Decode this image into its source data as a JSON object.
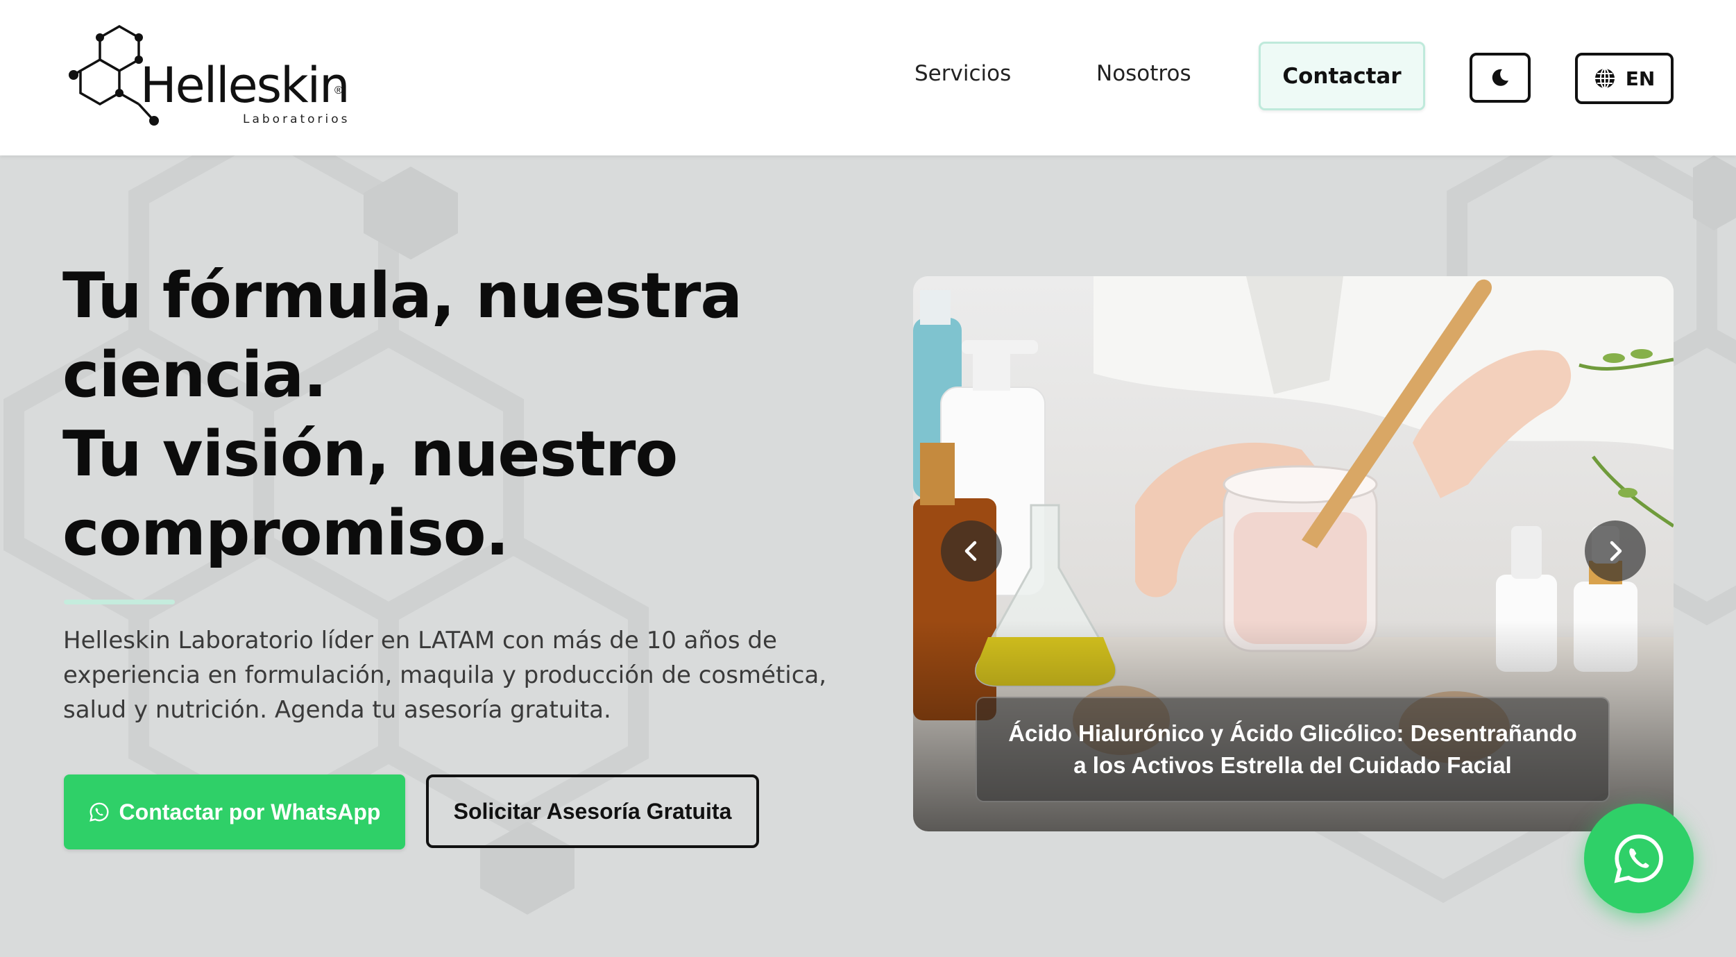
{
  "brand": {
    "name": "Helleskin",
    "subtitle": "Laboratorios",
    "registered": "®"
  },
  "nav": {
    "links": [
      {
        "label": "Servicios"
      },
      {
        "label": "Nosotros"
      }
    ],
    "contact_label": "Contactar",
    "theme_icon": "moon-icon",
    "language": {
      "icon": "globe-icon",
      "label": "EN"
    }
  },
  "hero": {
    "title_lines": [
      "Tu fórmula, nuestra",
      "ciencia.",
      "Tu visión, nuestro",
      "compromiso."
    ],
    "description": "Helleskin Laboratorio líder en LATAM con más de 10 años de experiencia en formulación, maquila y producción de cosmética, salud y nutrición. Agenda tu asesoría gratuita.",
    "whatsapp_button": "Contactar por WhatsApp",
    "consult_button": "Solicitar Asesoría Gratuita"
  },
  "carousel": {
    "caption": "Ácido Hialurónico y Ácido Glicólico: Desentrañando a los Activos Estrella del Cuidado Facial",
    "prev_icon": "chevron-left-icon",
    "next_icon": "chevron-right-icon"
  },
  "floating": {
    "icon": "whatsapp-icon"
  },
  "colors": {
    "accent_green": "#2fd068",
    "mint": "#c5ecdd",
    "background": "#d9dbdb"
  }
}
